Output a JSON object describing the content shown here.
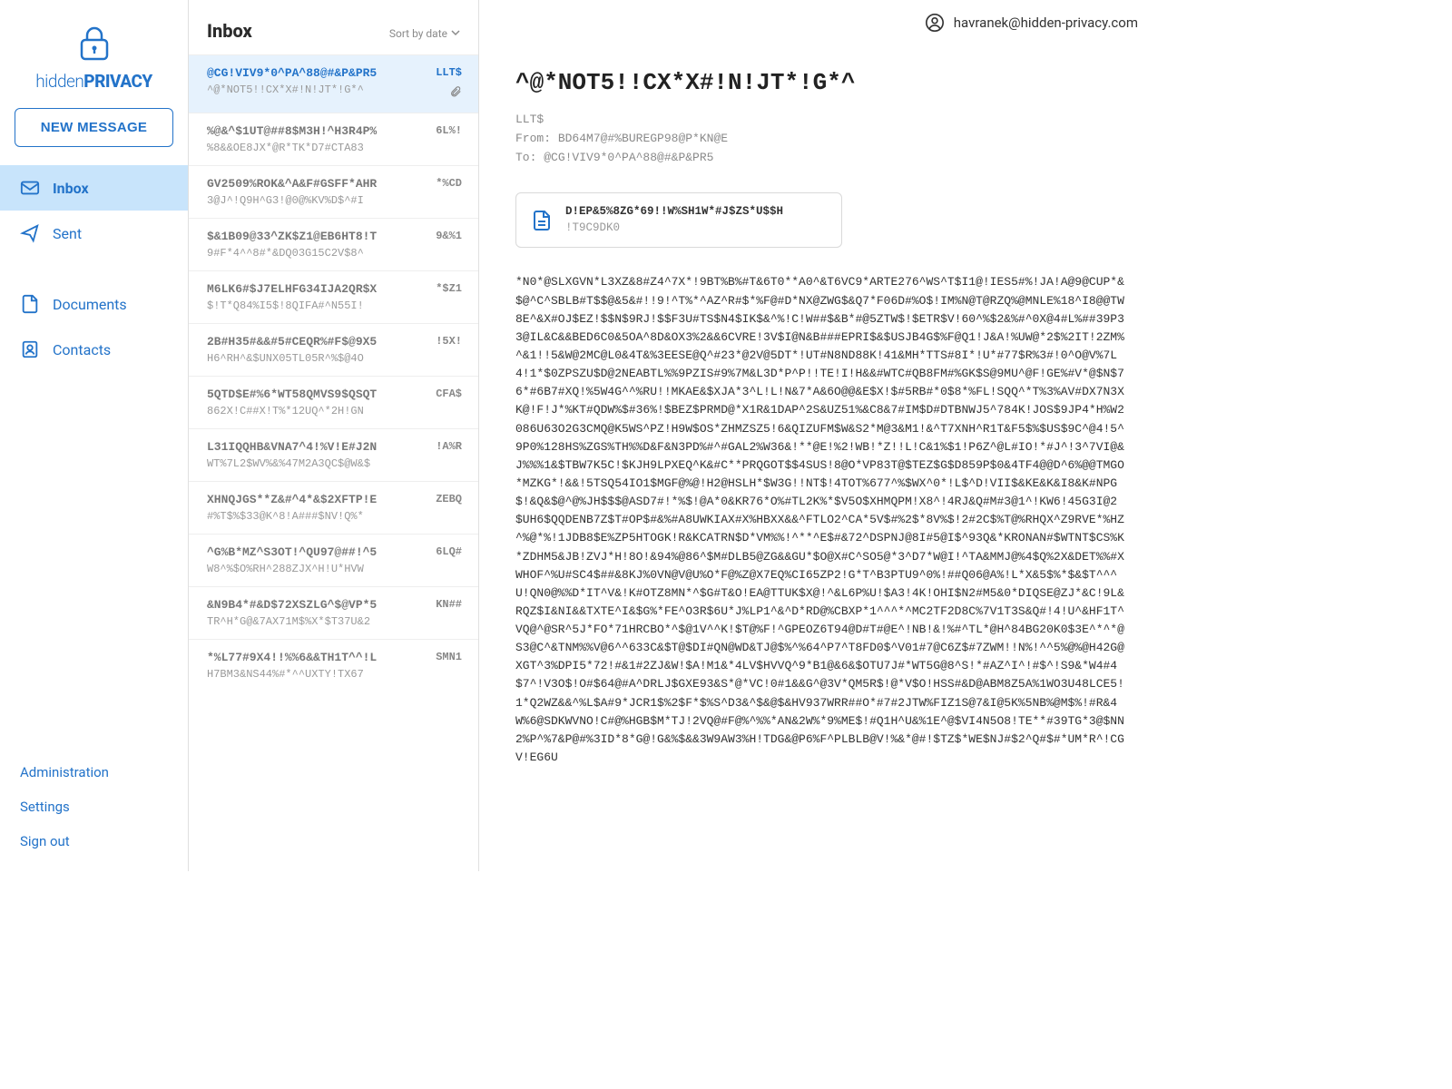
{
  "brand": {
    "name_thin": "hidden",
    "name_bold": "PRIVACY"
  },
  "new_message_label": "NEW MESSAGE",
  "nav": {
    "inbox": "Inbox",
    "sent": "Sent",
    "documents": "Documents",
    "contacts": "Contacts"
  },
  "footer_links": {
    "administration": "Administration",
    "settings": "Settings",
    "signout": "Sign out"
  },
  "list": {
    "title": "Inbox",
    "sort_label": "Sort by date"
  },
  "emails": [
    {
      "to": "@CG!VIV9*0^PA^88@#&P&PR5",
      "subject": "^@*NOT5!!CX*X#!N!JT*!G*^",
      "date": "LLT$",
      "has_attachment": true,
      "selected": true
    },
    {
      "to": "%@&^$1UT@##8$M3H!^H3R4P%",
      "subject": "%8&&OE8JX*@R*TK*D7#CTA83",
      "date": "6L%!"
    },
    {
      "to": "GV2509%ROK&^A&F#GSFF*AHR",
      "subject": "3@J^!Q9H^G3!@0@%KV%D$^#I",
      "date": "*%CD"
    },
    {
      "to": "$&1B09@33^ZK$Z1@EB6HT8!T",
      "subject": "9#F*4^^8#*&DQ03G15C2V$8^",
      "date": "9&%1"
    },
    {
      "to": "M6LK6#$J7ELHFG34IJA2QR$X",
      "subject": "$!T*Q84%I5$!8QIFA#^N55I!",
      "date": "*$Z1"
    },
    {
      "to": "2B#H35#&&#5#CEQR%#F$@9X5",
      "subject": "H6^RH^&$UNX05TL05R^%$@4O",
      "date": "!5X!"
    },
    {
      "to": "5QTD$E#%6*WT58QMVS9$QSQT",
      "subject": "862X!C##X!T%*12UQ^*2H!GN",
      "date": "CFA$"
    },
    {
      "to": "L31IQQHB&VNA7^4!%V!E#J2N",
      "subject": "WT%7L2$WV%&%47M2A3QC$@W&$",
      "date": "!A%R"
    },
    {
      "to": "XHNQJGS**Z&#^4*&$2XFTP!E",
      "subject": "#%T$%$33@K^8!A###$NV!Q%*",
      "date": "ZEBQ"
    },
    {
      "to": "^G%B*MZ^S3OT!^QU97@##!^5",
      "subject": "W8^%$O%RH^288ZJX^H!U*HVW",
      "date": "6LQ#"
    },
    {
      "to": "&N9B4*#&D$72XSZLG^$@VP*5",
      "subject": "TR^H*G@&7AX71M$%X*$T37U&2",
      "date": "KN##"
    },
    {
      "to": "*%L77#9X4!!%%6&&TH1T^^!L",
      "subject": "H7BM3&NS44%#*^^UXTY!TX67",
      "date": "SMN1"
    }
  ],
  "top": {
    "user_email": "havranek@hidden-privacy.com"
  },
  "message": {
    "subject": "^@*NOT5!!CX*X#!N!JT*!G*^",
    "date": "LLT$",
    "from_label": "From:",
    "from": "BD64M7@#%BUREGP98@P*KN@E",
    "to_label": "To:",
    "to": "@CG!VIV9*0^PA^88@#&P&PR5",
    "attachment": {
      "name": "D!EP&5%8ZG*69!!W%SH1W*#J$ZS*U$$H",
      "size": "!T9C9DK0"
    },
    "body": "*N0*@SLXGVN*L3XZ&8#Z4^7X*!9BT%B%#T&6T0**A0^&T6VC9*ARTE276^WS^T$I1@!IES5#%!JA!A@9@CUP*&$@^C^SBLB#T$$@&5&#!!9!^T%*^AZ^R#$*%F@#D*NX@ZWG$&Q7*F06D#%O$!IM%N@T@RZQ%@MNLE%18^I8@@TW8E^&X#OJ$EZ!$$N$9RJ!$$F3U#TS$N4$IK$&^%!C!W##$&B*#@5ZTW$!$ETR$V!60^%$2&%#^0X@4#L%##39P33@IL&C&&BED6C0&5OA^8D&OX3%2&&6CVRE!3V$I@N&B###EPRI$&$USJB4G$%F@Q1!J&A!%UW@*2$%2IT!2ZM%^&1!!5&W@2MC@L0&4T&%3EESE@Q^#23*@2V@5DT*!UT#N8ND88K!41&MH*TTS#8I*!U*#77$R%3#!0^O@V%7L4!1*$0ZPSZU$D@2NEABTL%%9PZIS#9%7M&L3D*P^P!!TE!I!H&&#WTC#QB8FM#%GK$S@9MU^@F!GE%#V*@$N$76*#6B7#XQ!%5W4G^^%RU!!MKAE&$XJA*3^L!L!N&7*A&6O@@&E$X!$#5RB#*0$8*%FL!SQQ^*T%3%AV#DX7N3XK@!F!J*%KT#QDW%$#36%!$BEZ$PRMD@*X1R&1DAP^2S&UZ51%&C8&7#IM$D#DTBNWJ5^784K!JOS$9JP4*H%W2086U63O2G3CMQ@K5WS^PZ!H9W$OS*ZHMZSZ5!6&QIZUFM$W&S2*M@3&M1!&^T7XNH^R1T&F5$%$US$9C^@4!5^9P0%128HS%ZGS%TH%%D&F&N3PD%#^#GAL2%W36&!**@E!%2!WB!*Z!!L!C&1%$1!P6Z^@L#IO!*#J^!3^7VI@&J%%%1&$TBW7K5C!$KJH9LPXEQ^K&#C**PRQGOT$$4SUS!8@O*VP83T@$TEZ$G$D859P$0&4TF4@@D^6%@@TMGO*MZKG*!&&!5TSQ54IO1$MGF@%@!H2@HSLH*$W3G!!NT$!4TOT%677^%$WX^0*!L$^D!VII$&KE&K&I8&K#NPG$!&Q&$@^@%JH$$$@ASD7#!*%$!@A*0&KR76*O%#TL2K%*$V5O$XHMQPM!X8^!4RJ&Q#M#3@1^!KW6!45G3I@2$UH6$QQDENB7Z$T#OP$#&%#A8UWKIAX#X%HBXX&&^FTLO2^CA*5V$#%2$*8V%$!2#2C$%T@%RHQX^Z9RVE*%HZ^%@*%!1JDB8$E%ZP5HTOGK!R&KCATRN$D*VM%%!^**^E$#&72^DSPNJ@8I#5@I$^93Q&*KRONAN#$WTNT$CS%K*ZDHM5&JB!ZVJ*H!8O!&94%@86^$M#DLB5@ZG&&GU*$O@X#C^SO5@*3^D7*W@I!^TA&MMJ@%4$Q%2X&DET%%#XWHOF^%U#SC4$##&8KJ%0VN@V@U%O*F@%Z@X7EQ%CI65ZP2!G*T^B3PTU9^0%!##Q06@A%!L*X&5$%*$&$T^^^U!QN0@%%D*IT^V&!K#OTZ8MN*^$G#T&O!EA@TTUK$X@!^&L6P%U!$A3!4K!OHI$N2#M5&0*DIQSE@ZJ*&C!9L&RQZ$I&NI&&TXTE^I&$G%*FE^O3R$6U*J%LP1^&^D*RD@%CBXP*1^^^*^MC2TF2D8C%7V1T3S&Q#!4!U^&HF1T^VQ@^@SR^5J*FO*71HRCBO*^$@1V^^K!$T@%F!^GPEOZ6T94@D#T#@E^!NB!&!%#^TL*@H^84BG20K0$3E^*^*@S3@C^&TNM%%V@6^^633C&$T@$DI#QN@WD&TJ@$%^%64^P7^T8FD0$^V01#7@C6Z$#7ZWM!!N%!^^5%@%@H42G@XGT^3%DPI5*72!#&1#2ZJ&W!$A!M1&*4LV$HVVQ^9*B1@&6&$OTU7J#*WT5G@8^S!*#AZ^I^!#$^!S9&*W4#4$7^!V3O$!O#$64@#A^DRLJ$GXE93&S*@*VC!0#1&&G^@3V*QM5R$!@*V$O!HSS#&D@ABM8Z5A%1WO3U48LCE5!1*Q2WZ&&^%L$A#9*JCR1$%2$F*$%S^D3&^$&@$&HV937WRR##O*#7#2JTW%FIZ1S@7&I@5K%5NB%@M$%!#R&4W%6@SDKWVNO!C#@%HGB$M*TJ!2VQ@#F@%^%%*AN&2W%*9%ME$!#Q1H^U&%1E^@$VI4N5O8!TE**#39TG*3@$NN2%P^%7&P@#%3ID*8*G@!G&%$&&3W9AW3%H!TDG&@P6%F^PLBLB@V!%&*@#!$TZ$*WE$NJ#$2^Q#$#*UM*R^!CGV!EG6U"
  }
}
